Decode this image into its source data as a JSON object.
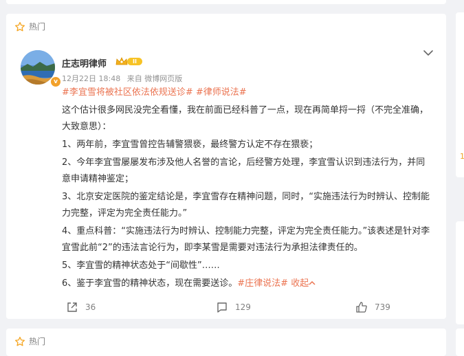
{
  "feed": {
    "hot_label": "热门",
    "post": {
      "author": "庄志明律师",
      "level": "II",
      "verified_mark": "v",
      "time": "12月22日 18:48",
      "source": "来自 微博网页版",
      "tags_line": "#李宜雪将被社区依法依规送诊# #律师说法#",
      "paragraphs": [
        "这个估计很多网民没完全看懂，我在前面已经科普了一点，现在再简单捋一捋（不完全准确，大致意思）：",
        "1、两年前，李宜雪曾控告辅警猥亵，最终警方认定不存在猥亵；",
        "2、今年李宜雪屡屡发布涉及他人名誉的言论，后经警方处理，李宜雪认识到违法行为，并同意申请精神鉴定；",
        "3、北京安定医院的鉴定结论是，李宜雪存在精神问题，同时，“实施违法行为时辨认、控制能力完整，评定为完全责任能力。”",
        "4、重点科普：“实施违法行为时辨认、控制能力完整，评定为完全责任能力。”该表述是针对李宜雪此前“2”的违法言论行为，即李某雪是需要对违法行为承担法律责任的。",
        "5、李宜雪的精神状态处于“间歇性”……"
      ],
      "last_paragraph_text": "6、鉴于李宜雪的精神状态，现在需要送诊。",
      "last_tag": "#庄律说法#",
      "collapse_label": "收起",
      "forward_count": "36",
      "comment_count": "129",
      "like_count": "739"
    },
    "side_mark": "1"
  },
  "colors": {
    "tag": "#eb7350",
    "star": "#f5a623",
    "background": "#f1f2f5"
  }
}
